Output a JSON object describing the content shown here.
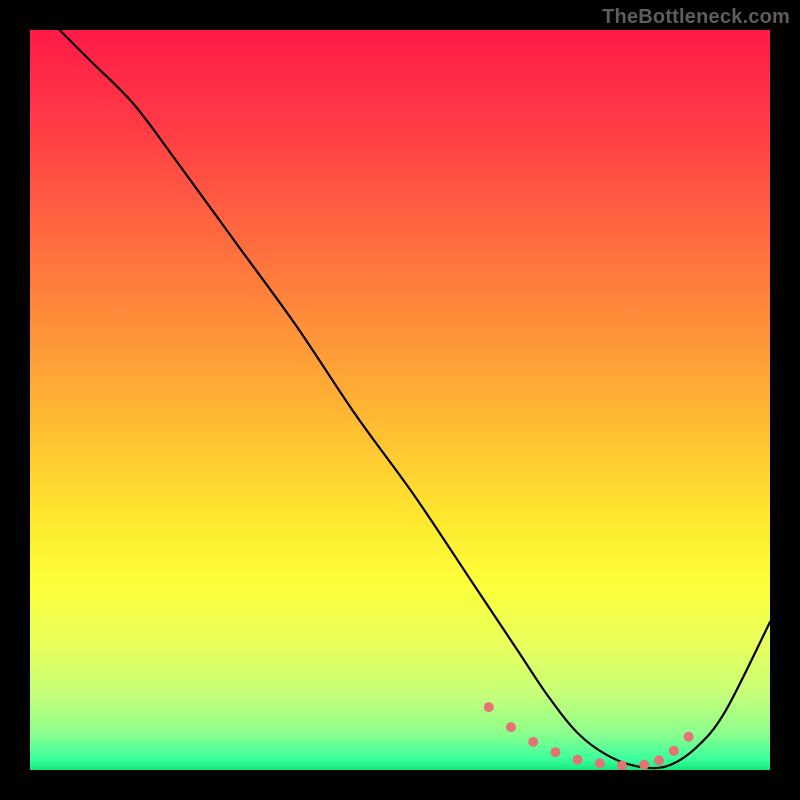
{
  "attribution": "TheBottleneck.com",
  "gradient_stops": [
    {
      "offset": 0.0,
      "color": "#ff1a47"
    },
    {
      "offset": 0.14,
      "color": "#ff3e45"
    },
    {
      "offset": 0.28,
      "color": "#ff6a3f"
    },
    {
      "offset": 0.42,
      "color": "#ff9639"
    },
    {
      "offset": 0.55,
      "color": "#ffc232"
    },
    {
      "offset": 0.66,
      "color": "#ffe82f"
    },
    {
      "offset": 0.75,
      "color": "#fdff3a"
    },
    {
      "offset": 0.83,
      "color": "#e9ff5c"
    },
    {
      "offset": 0.9,
      "color": "#c4ff7a"
    },
    {
      "offset": 0.95,
      "color": "#8dff8d"
    },
    {
      "offset": 0.985,
      "color": "#3bff9d"
    },
    {
      "offset": 1.0,
      "color": "#16e87c"
    }
  ],
  "chart_data": {
    "type": "line",
    "title": "",
    "xlabel": "",
    "ylabel": "",
    "xlim": [
      0,
      100
    ],
    "ylim": [
      0,
      100
    ],
    "series": [
      {
        "name": "bottleneck-curve",
        "x": [
          4,
          8,
          14,
          20,
          28,
          36,
          44,
          52,
          60,
          66,
          70,
          74,
          78,
          82,
          86,
          90,
          94,
          100
        ],
        "y": [
          100,
          96,
          90,
          82,
          71,
          60,
          48,
          37,
          25,
          16,
          10,
          5,
          2,
          0.5,
          0.5,
          3,
          8,
          20
        ]
      }
    ],
    "markers": {
      "name": "highlight-dots",
      "color": "#e57373",
      "x": [
        62,
        65,
        68,
        71,
        74,
        77,
        80,
        83,
        85,
        87,
        89
      ],
      "y": [
        8.5,
        5.8,
        3.8,
        2.4,
        1.4,
        0.9,
        0.6,
        0.7,
        1.3,
        2.6,
        4.5
      ]
    }
  }
}
